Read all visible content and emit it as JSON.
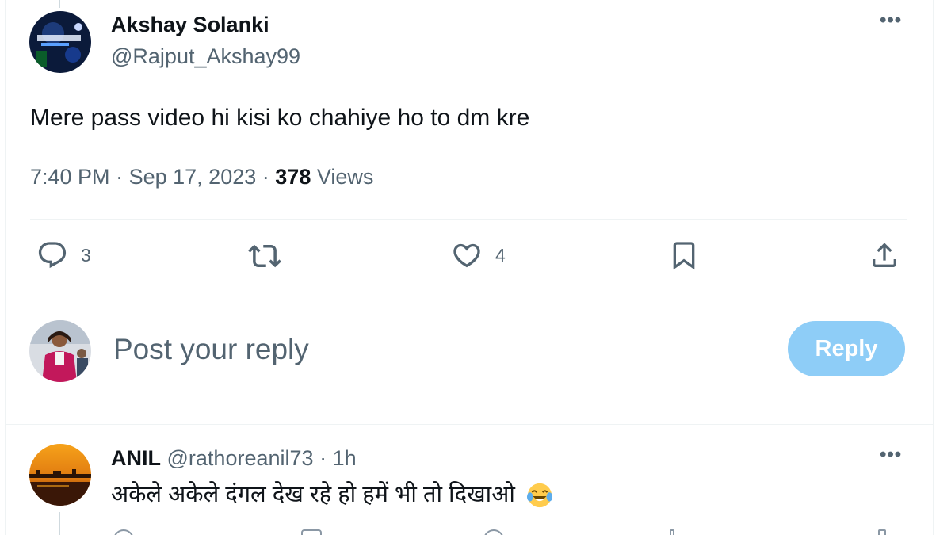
{
  "tweet": {
    "author_name": "Akshay Solanki",
    "author_handle": "@Rajput_Akshay99",
    "more_icon": "more-horizontal-icon",
    "text": "Mere pass video hi kisi ko chahiye ho to dm kre",
    "time": "7:40 PM",
    "date": "Sep 17, 2023",
    "separator": "·",
    "views_count": "378",
    "views_label": "Views",
    "actions": {
      "reply": {
        "icon": "reply-icon",
        "count": "3"
      },
      "retweet": {
        "icon": "retweet-icon"
      },
      "like": {
        "icon": "heart-icon",
        "count": "4"
      },
      "bookmark": {
        "icon": "bookmark-icon"
      },
      "share": {
        "icon": "share-icon"
      }
    }
  },
  "composer": {
    "placeholder": "Post your reply",
    "button_label": "Reply",
    "button_color": "#8ecdf7"
  },
  "replies": [
    {
      "name": "ANIL",
      "handle": "@rathoreanil73",
      "separator": "·",
      "time": "1h",
      "text": "अकेले अकेले दंगल देख रहे हो हमें भी तो दिखाओ",
      "emoji_icon": "laughing-tears-emoji-icon"
    }
  ],
  "colors": {
    "text_primary": "#0f1419",
    "text_secondary": "#536471",
    "divider": "#eff3f4",
    "accent": "#1d9bf0"
  }
}
